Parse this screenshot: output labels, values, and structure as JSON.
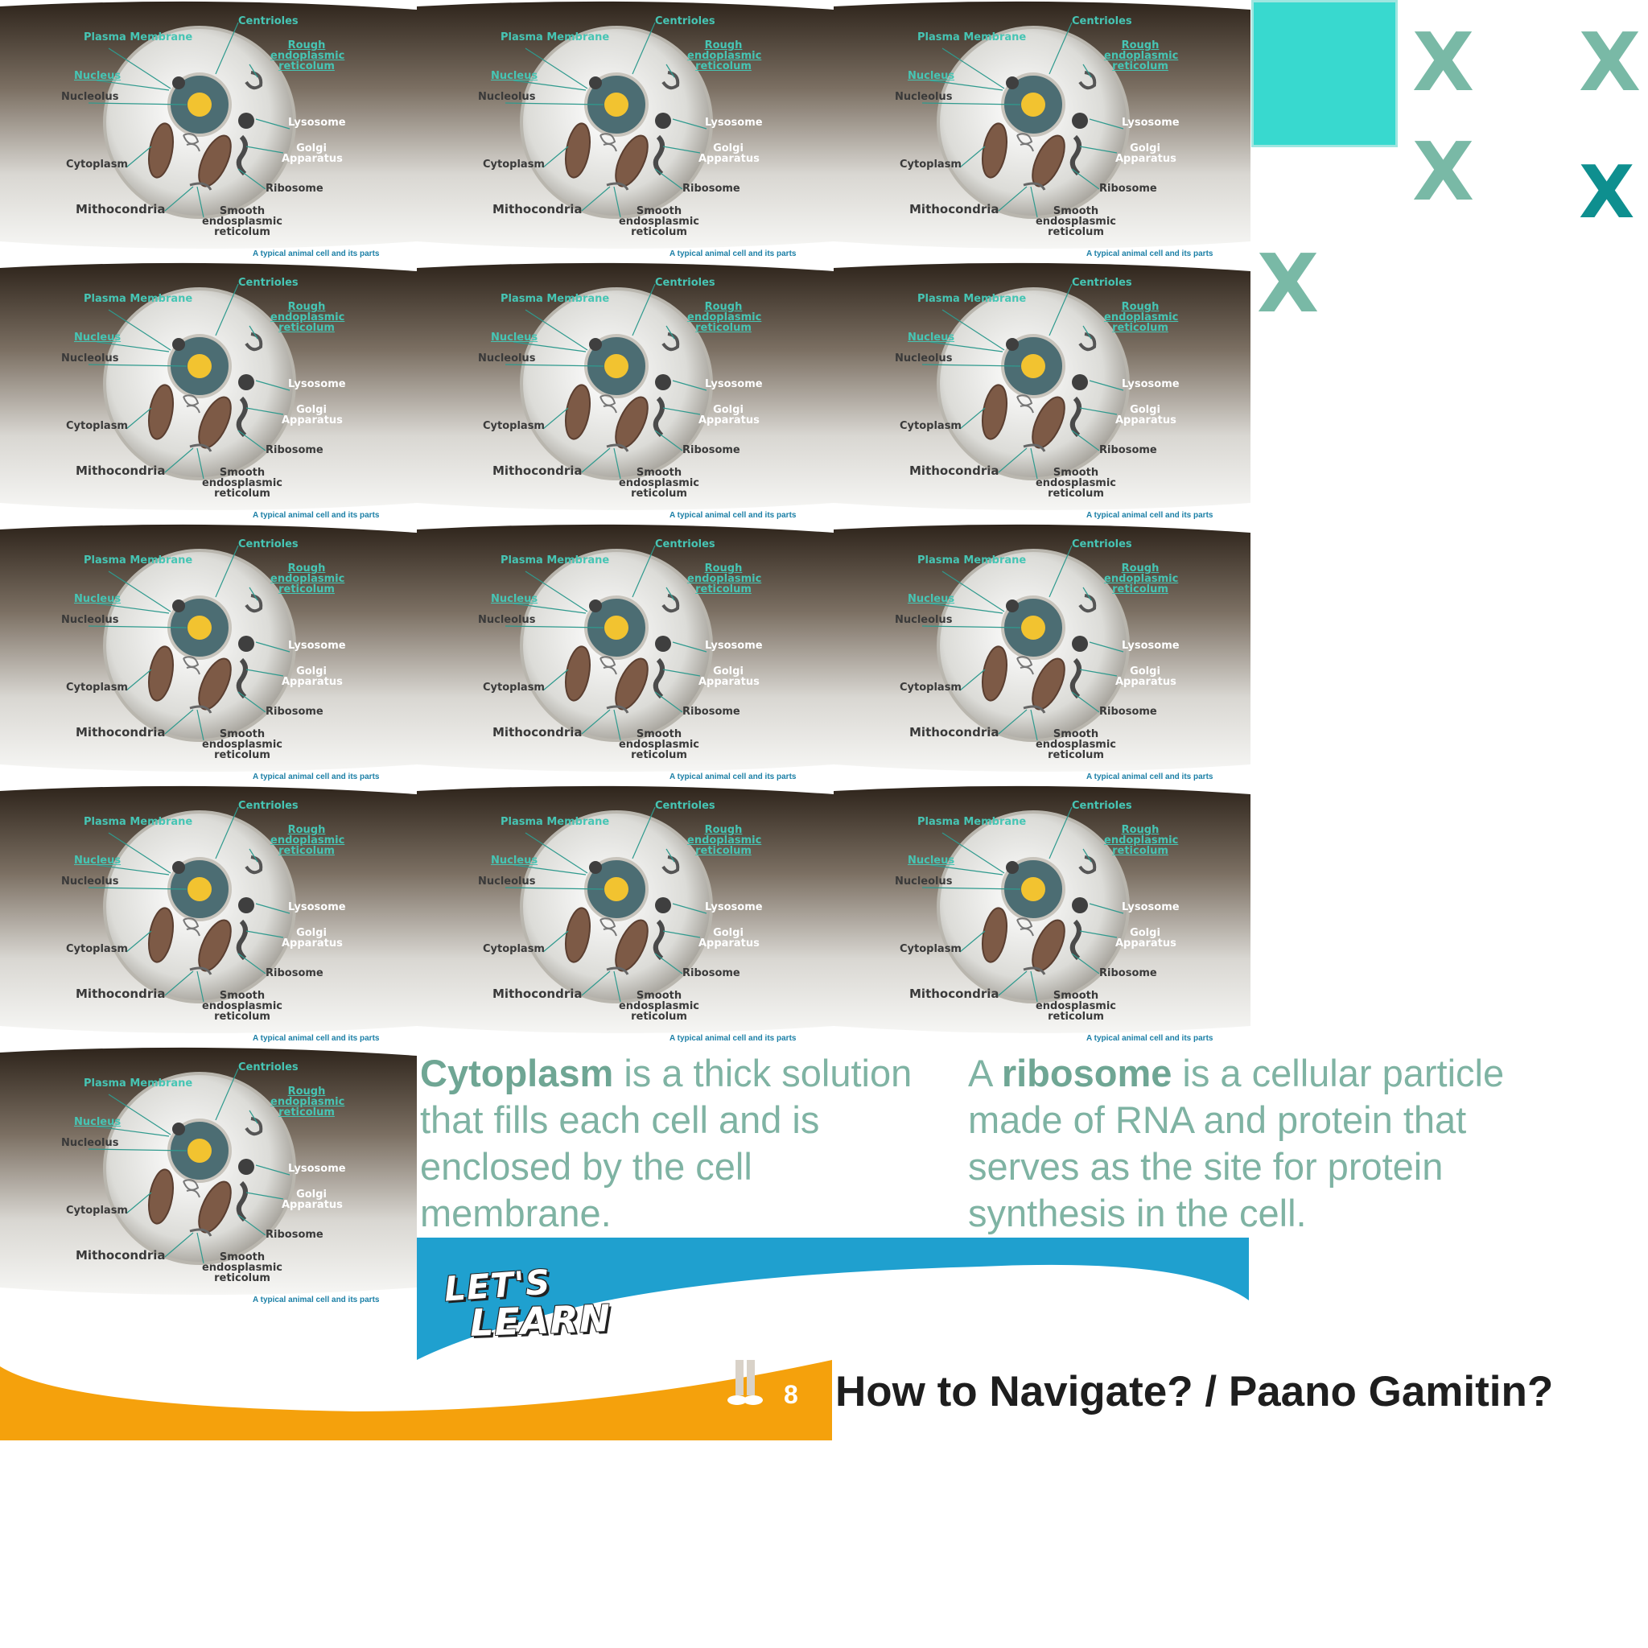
{
  "cell_diagram": {
    "labels": {
      "plasma_membrane": "Plasma Membrane",
      "centrioles": "Centrioles",
      "rough_er": "Rough endoplasmic reticolum",
      "nucleus": "Nucleus",
      "nucleolus": "Nucleolus",
      "lysosome": "Lysosome",
      "golgi": "Golgi Apparatus",
      "cytoplasm": "Cytoplasm",
      "ribosome": "Ribosome",
      "mithocondria": "Mithocondria",
      "smooth_er": "Smooth endosplasmic reticolum"
    },
    "caption": "A typical animal cell and its parts",
    "tile_count": 13
  },
  "definitions": {
    "cytoplasm": {
      "term": "Cytoplasm",
      "text": " is a thick solution that fills each cell and is enclosed by the cell membrane."
    },
    "ribosome": {
      "prefix": "A ",
      "term": "ribosome",
      "text": " is a cellular particle made of RNA and protein that serves as the site for protein synthesis in the cell."
    }
  },
  "banner": {
    "line1": "LET'S",
    "line2": "LEARN"
  },
  "footer": {
    "page_number": "8",
    "nav_title": "How to Navigate? / Paano Gamitin?"
  },
  "decorations": {
    "x_glyph": "X",
    "x_count": 5
  },
  "colors": {
    "teal_square": "#38d9cf",
    "x_light": "#79b9a6",
    "x_dark": "#0e8f8f",
    "orange": "#f5a10c",
    "blue": "#1fa0cf"
  }
}
